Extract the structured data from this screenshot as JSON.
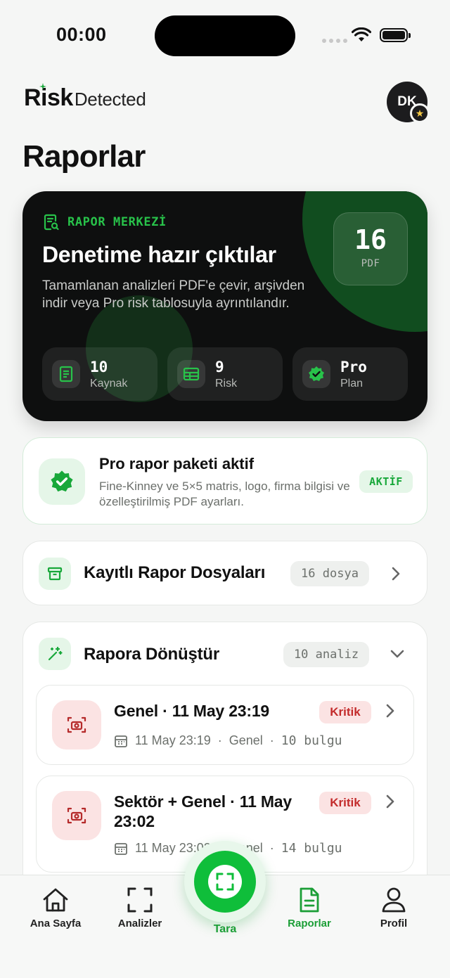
{
  "status_bar": {
    "time": "00:00"
  },
  "header": {
    "logo_risk": "Risk",
    "logo_detected": "Detected",
    "avatar_initials": "DK",
    "page_title": "Raporlar"
  },
  "hero": {
    "eyebrow": "RAPOR MERKEZİ",
    "title": "Denetime hazır çıktılar",
    "description": "Tamamlanan analizleri PDF'e çevir, arşivden indir veya Pro risk tablosuyla ayrıntılandır.",
    "count_value": "16",
    "count_label": "PDF",
    "stats": [
      {
        "value": "10",
        "label": "Kaynak",
        "icon": "document-icon"
      },
      {
        "value": "9",
        "label": "Risk",
        "icon": "table-icon"
      },
      {
        "value": "Pro",
        "label": "Plan",
        "icon": "verified-badge-icon"
      }
    ]
  },
  "pro_card": {
    "title": "Pro rapor paketi aktif",
    "description": "Fine-Kinney ve 5×5 matris, logo, firma bilgisi ve özelleştirilmiş PDF ayarları.",
    "badge": "AKTİF"
  },
  "files_card": {
    "title": "Kayıtlı Rapor Dosyaları",
    "count": "16 dosya"
  },
  "convert": {
    "title": "Rapora Dönüştür",
    "count": "10 analiz",
    "items": [
      {
        "title": "Genel · 11 May 23:19",
        "badge": "Kritik",
        "date": "11 May 23:19",
        "category": "Genel",
        "findings": "10 bulgu"
      },
      {
        "title": "Sektör + Genel · 11 May 23:02",
        "badge": "Kritik",
        "date": "11 May 23:02",
        "category": "Genel",
        "findings": "14 bulgu"
      }
    ]
  },
  "nav": {
    "home": "Ana Sayfa",
    "analyses": "Analizler",
    "scan": "Tara",
    "reports": "Raporlar",
    "profile": "Profil"
  },
  "colors": {
    "accent": "#0fbe3a",
    "accent_dark": "#1b9e36",
    "critical": "#c32b2b",
    "hero_bg": "#0e0f0f"
  }
}
